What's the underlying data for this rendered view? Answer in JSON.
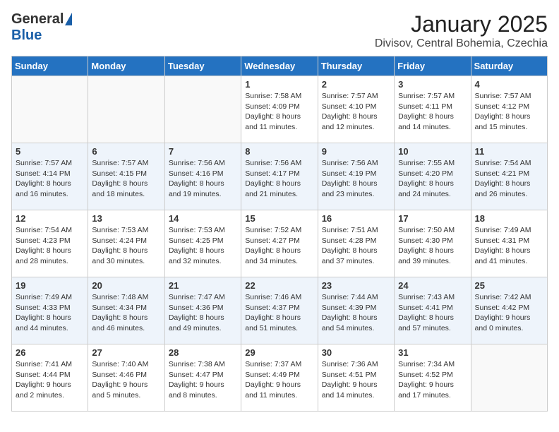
{
  "header": {
    "logo_general": "General",
    "logo_blue": "Blue",
    "month_title": "January 2025",
    "location": "Divisov, Central Bohemia, Czechia"
  },
  "days_of_week": [
    "Sunday",
    "Monday",
    "Tuesday",
    "Wednesday",
    "Thursday",
    "Friday",
    "Saturday"
  ],
  "weeks": [
    {
      "alt": false,
      "days": [
        {
          "number": "",
          "info": ""
        },
        {
          "number": "",
          "info": ""
        },
        {
          "number": "",
          "info": ""
        },
        {
          "number": "1",
          "info": "Sunrise: 7:58 AM\nSunset: 4:09 PM\nDaylight: 8 hours\nand 11 minutes."
        },
        {
          "number": "2",
          "info": "Sunrise: 7:57 AM\nSunset: 4:10 PM\nDaylight: 8 hours\nand 12 minutes."
        },
        {
          "number": "3",
          "info": "Sunrise: 7:57 AM\nSunset: 4:11 PM\nDaylight: 8 hours\nand 14 minutes."
        },
        {
          "number": "4",
          "info": "Sunrise: 7:57 AM\nSunset: 4:12 PM\nDaylight: 8 hours\nand 15 minutes."
        }
      ]
    },
    {
      "alt": true,
      "days": [
        {
          "number": "5",
          "info": "Sunrise: 7:57 AM\nSunset: 4:14 PM\nDaylight: 8 hours\nand 16 minutes."
        },
        {
          "number": "6",
          "info": "Sunrise: 7:57 AM\nSunset: 4:15 PM\nDaylight: 8 hours\nand 18 minutes."
        },
        {
          "number": "7",
          "info": "Sunrise: 7:56 AM\nSunset: 4:16 PM\nDaylight: 8 hours\nand 19 minutes."
        },
        {
          "number": "8",
          "info": "Sunrise: 7:56 AM\nSunset: 4:17 PM\nDaylight: 8 hours\nand 21 minutes."
        },
        {
          "number": "9",
          "info": "Sunrise: 7:56 AM\nSunset: 4:19 PM\nDaylight: 8 hours\nand 23 minutes."
        },
        {
          "number": "10",
          "info": "Sunrise: 7:55 AM\nSunset: 4:20 PM\nDaylight: 8 hours\nand 24 minutes."
        },
        {
          "number": "11",
          "info": "Sunrise: 7:54 AM\nSunset: 4:21 PM\nDaylight: 8 hours\nand 26 minutes."
        }
      ]
    },
    {
      "alt": false,
      "days": [
        {
          "number": "12",
          "info": "Sunrise: 7:54 AM\nSunset: 4:23 PM\nDaylight: 8 hours\nand 28 minutes."
        },
        {
          "number": "13",
          "info": "Sunrise: 7:53 AM\nSunset: 4:24 PM\nDaylight: 8 hours\nand 30 minutes."
        },
        {
          "number": "14",
          "info": "Sunrise: 7:53 AM\nSunset: 4:25 PM\nDaylight: 8 hours\nand 32 minutes."
        },
        {
          "number": "15",
          "info": "Sunrise: 7:52 AM\nSunset: 4:27 PM\nDaylight: 8 hours\nand 34 minutes."
        },
        {
          "number": "16",
          "info": "Sunrise: 7:51 AM\nSunset: 4:28 PM\nDaylight: 8 hours\nand 37 minutes."
        },
        {
          "number": "17",
          "info": "Sunrise: 7:50 AM\nSunset: 4:30 PM\nDaylight: 8 hours\nand 39 minutes."
        },
        {
          "number": "18",
          "info": "Sunrise: 7:49 AM\nSunset: 4:31 PM\nDaylight: 8 hours\nand 41 minutes."
        }
      ]
    },
    {
      "alt": true,
      "days": [
        {
          "number": "19",
          "info": "Sunrise: 7:49 AM\nSunset: 4:33 PM\nDaylight: 8 hours\nand 44 minutes."
        },
        {
          "number": "20",
          "info": "Sunrise: 7:48 AM\nSunset: 4:34 PM\nDaylight: 8 hours\nand 46 minutes."
        },
        {
          "number": "21",
          "info": "Sunrise: 7:47 AM\nSunset: 4:36 PM\nDaylight: 8 hours\nand 49 minutes."
        },
        {
          "number": "22",
          "info": "Sunrise: 7:46 AM\nSunset: 4:37 PM\nDaylight: 8 hours\nand 51 minutes."
        },
        {
          "number": "23",
          "info": "Sunrise: 7:44 AM\nSunset: 4:39 PM\nDaylight: 8 hours\nand 54 minutes."
        },
        {
          "number": "24",
          "info": "Sunrise: 7:43 AM\nSunset: 4:41 PM\nDaylight: 8 hours\nand 57 minutes."
        },
        {
          "number": "25",
          "info": "Sunrise: 7:42 AM\nSunset: 4:42 PM\nDaylight: 9 hours\nand 0 minutes."
        }
      ]
    },
    {
      "alt": false,
      "days": [
        {
          "number": "26",
          "info": "Sunrise: 7:41 AM\nSunset: 4:44 PM\nDaylight: 9 hours\nand 2 minutes."
        },
        {
          "number": "27",
          "info": "Sunrise: 7:40 AM\nSunset: 4:46 PM\nDaylight: 9 hours\nand 5 minutes."
        },
        {
          "number": "28",
          "info": "Sunrise: 7:38 AM\nSunset: 4:47 PM\nDaylight: 9 hours\nand 8 minutes."
        },
        {
          "number": "29",
          "info": "Sunrise: 7:37 AM\nSunset: 4:49 PM\nDaylight: 9 hours\nand 11 minutes."
        },
        {
          "number": "30",
          "info": "Sunrise: 7:36 AM\nSunset: 4:51 PM\nDaylight: 9 hours\nand 14 minutes."
        },
        {
          "number": "31",
          "info": "Sunrise: 7:34 AM\nSunset: 4:52 PM\nDaylight: 9 hours\nand 17 minutes."
        },
        {
          "number": "",
          "info": ""
        }
      ]
    }
  ]
}
